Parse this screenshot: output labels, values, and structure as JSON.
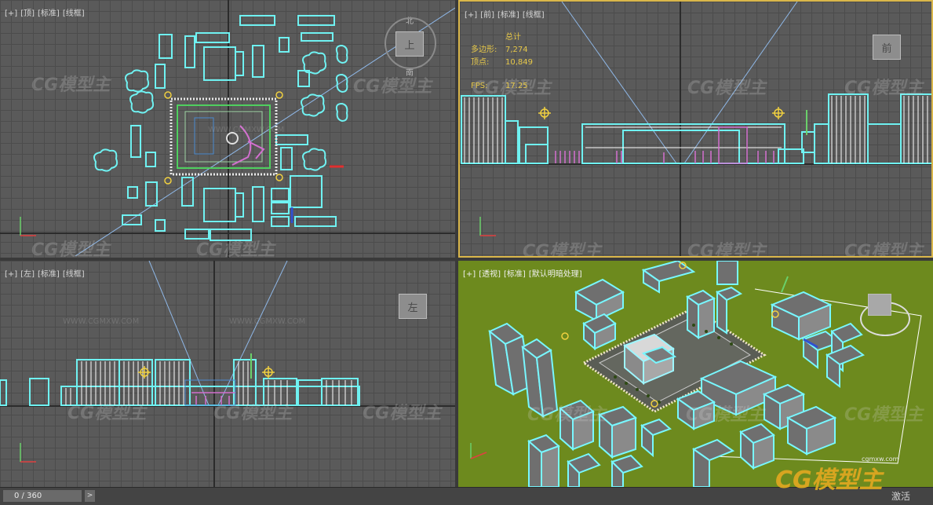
{
  "viewports": {
    "top": {
      "plus": "[+]",
      "view": "[顶]",
      "shading": "[标准]",
      "mode": "[线框]",
      "cube": "上",
      "north": "北",
      "south": "南"
    },
    "front": {
      "plus": "[+]",
      "view": "[前]",
      "shading": "[标准]",
      "mode": "[线框]",
      "cube": "前",
      "stats": {
        "total_label": "总计",
        "poly_label": "多边形:",
        "poly_value": "7,274",
        "vert_label": "顶点:",
        "vert_value": "10,849",
        "fps_label": "FPS:",
        "fps_value": "17.25"
      }
    },
    "left": {
      "plus": "[+]",
      "view": "[左]",
      "shading": "[标准]",
      "mode": "[线框]",
      "cube": "左"
    },
    "persp": {
      "plus": "[+]",
      "view": "[透视]",
      "shading": "[标准]",
      "mode": "[默认明暗处理]"
    }
  },
  "watermark": {
    "text": "CG模型主",
    "url": "WWW.CGMXW.COM"
  },
  "timeline": {
    "frame": "0 / 360",
    "next_arrow": ">"
  },
  "activate_text": "激活",
  "brand": {
    "text": "CG模型主",
    "url": "cgmxw.com"
  },
  "colors": {
    "wire": "#6ff2f2",
    "viewport_bg": "#5a5a5a",
    "active_border": "#d9b64a",
    "ground": "#6d8a1e",
    "pink": "#d36fd0"
  }
}
